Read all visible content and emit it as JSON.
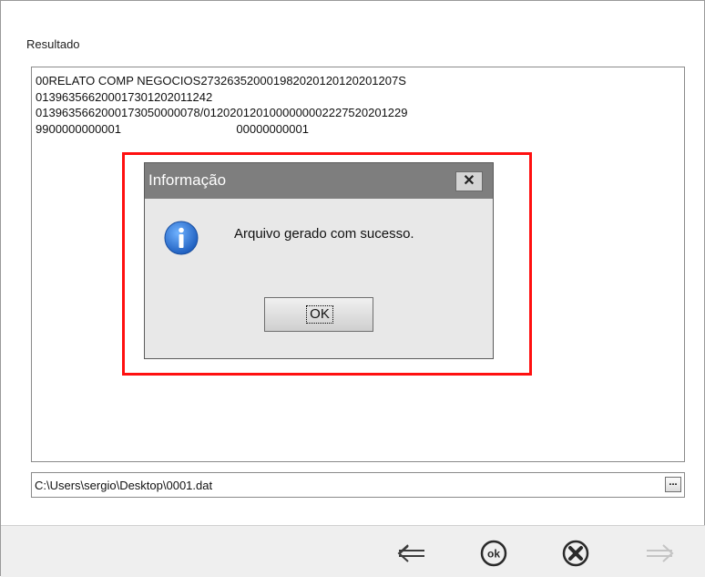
{
  "section": {
    "label": "Resultado"
  },
  "result": {
    "lines": [
      "00RELATO COMP NEGOCIOS27326352000198202012012020120​7S",
      "01396356620001730120201124​2",
      "0139635662000173050000078/012020120100000000222752020122​9",
      "9900000000001                                   00000000001"
    ]
  },
  "path": {
    "value": "C:\\Users\\sergio\\Desktop\\0001.dat",
    "browse_label": "..."
  },
  "dialog": {
    "title": "Informação",
    "close_label": "✕",
    "message": "Arquivo gerado com sucesso.",
    "ok_label": "OK"
  },
  "bottom_bar": {
    "icons": [
      "back-arrow-icon",
      "ok-circle-icon",
      "cancel-circle-icon",
      "forward-arrow-icon"
    ]
  },
  "colors": {
    "highlight": "#ff1010",
    "dialog_titlebar": "#7e7e7e",
    "info_icon": "#1f6fd1"
  }
}
